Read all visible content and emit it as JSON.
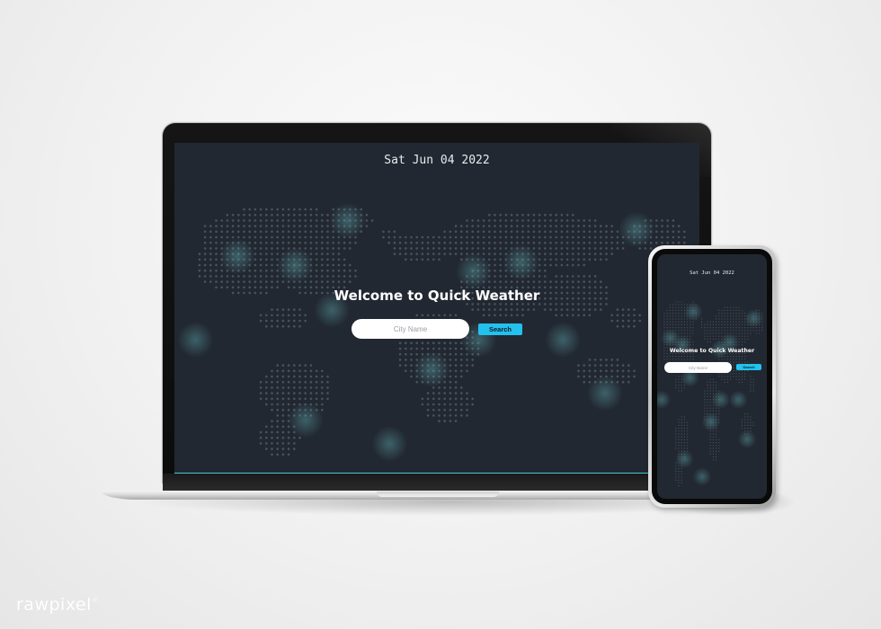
{
  "app": {
    "date": "Sat Jun 04 2022",
    "welcome_title": "Welcome to Quick Weather",
    "search": {
      "placeholder": "City Name",
      "value": "",
      "button_label": "Search"
    }
  },
  "colors": {
    "background": "#222831",
    "accent": "#23c1ee",
    "title": "#ffffff",
    "date": "#e8ecf0"
  },
  "watermark": "rawpixel"
}
